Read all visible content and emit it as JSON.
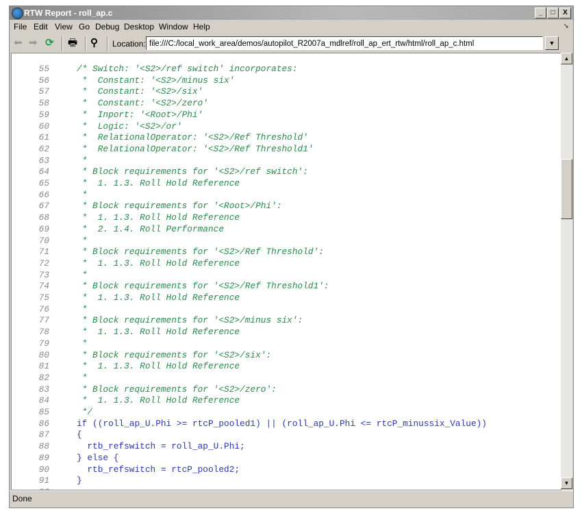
{
  "window": {
    "title": "RTW Report - roll_ap.c",
    "controls": [
      "_",
      "□",
      "X"
    ]
  },
  "menu": [
    "File",
    "Edit",
    "View",
    "Go",
    "Debug",
    "Desktop",
    "Window",
    "Help"
  ],
  "toolbar": {
    "location_label": "Location:",
    "location_value": "file:///C:/local_work_area/demos/autopilot_R2007a_mdlref/roll_ap_ert_rtw/html/roll_ap_c.html"
  },
  "code_lines": [
    {
      "n": "55",
      "text": "/* Switch: '<S2>/ref switch' incorporates:",
      "kind": "comment"
    },
    {
      "n": "56",
      "text": " *  Constant: '<S2>/minus six'",
      "kind": "comment"
    },
    {
      "n": "57",
      "text": " *  Constant: '<S2>/six'",
      "kind": "comment"
    },
    {
      "n": "58",
      "text": " *  Constant: '<S2>/zero'",
      "kind": "comment"
    },
    {
      "n": "59",
      "text": " *  Inport: '<Root>/Phi'",
      "kind": "comment"
    },
    {
      "n": "60",
      "text": " *  Logic: '<S2>/or'",
      "kind": "comment"
    },
    {
      "n": "61",
      "text": " *  RelationalOperator: '<S2>/Ref Threshold'",
      "kind": "comment"
    },
    {
      "n": "62",
      "text": " *  RelationalOperator: '<S2>/Ref Threshold1'",
      "kind": "comment"
    },
    {
      "n": "63",
      "text": " *",
      "kind": "comment"
    },
    {
      "n": "64",
      "text": " * Block requirements for '<S2>/ref switch':",
      "kind": "comment"
    },
    {
      "n": "65",
      "text": " *  1. 1.3. Roll Hold Reference",
      "kind": "comment"
    },
    {
      "n": "66",
      "text": " *",
      "kind": "comment"
    },
    {
      "n": "67",
      "text": " * Block requirements for '<Root>/Phi':",
      "kind": "comment"
    },
    {
      "n": "68",
      "text": " *  1. 1.3. Roll Hold Reference",
      "kind": "comment"
    },
    {
      "n": "69",
      "text": " *  2. 1.4. Roll Performance",
      "kind": "comment"
    },
    {
      "n": "70",
      "text": " *",
      "kind": "comment"
    },
    {
      "n": "71",
      "text": " * Block requirements for '<S2>/Ref Threshold':",
      "kind": "comment"
    },
    {
      "n": "72",
      "text": " *  1. 1.3. Roll Hold Reference",
      "kind": "comment"
    },
    {
      "n": "73",
      "text": " *",
      "kind": "comment"
    },
    {
      "n": "74",
      "text": " * Block requirements for '<S2>/Ref Threshold1':",
      "kind": "comment"
    },
    {
      "n": "75",
      "text": " *  1. 1.3. Roll Hold Reference",
      "kind": "comment"
    },
    {
      "n": "76",
      "text": " *",
      "kind": "comment"
    },
    {
      "n": "77",
      "text": " * Block requirements for '<S2>/minus six':",
      "kind": "comment"
    },
    {
      "n": "78",
      "text": " *  1. 1.3. Roll Hold Reference",
      "kind": "comment"
    },
    {
      "n": "79",
      "text": " *",
      "kind": "comment"
    },
    {
      "n": "80",
      "text": " * Block requirements for '<S2>/six':",
      "kind": "comment"
    },
    {
      "n": "81",
      "text": " *  1. 1.3. Roll Hold Reference",
      "kind": "comment"
    },
    {
      "n": "82",
      "text": " *",
      "kind": "comment"
    },
    {
      "n": "83",
      "text": " * Block requirements for '<S2>/zero':",
      "kind": "comment"
    },
    {
      "n": "84",
      "text": " *  1. 1.3. Roll Hold Reference",
      "kind": "comment"
    },
    {
      "n": "85",
      "text": " */",
      "kind": "comment"
    },
    {
      "n": "86",
      "text": "if ((roll_ap_U.Phi >= rtcP_pooled1) || (roll_ap_U.Phi <= rtcP_minussix_Value))",
      "kind": "code"
    },
    {
      "n": "87",
      "text": "{",
      "kind": "code"
    },
    {
      "n": "88",
      "text": "  rtb_refswitch = roll_ap_U.Phi;",
      "kind": "code"
    },
    {
      "n": "89",
      "text": "} else {",
      "kind": "code"
    },
    {
      "n": "90",
      "text": "  rtb_refswitch = rtcP_pooled2;",
      "kind": "code"
    },
    {
      "n": "91",
      "text": "}",
      "kind": "code"
    },
    {
      "n": "92",
      "text": "",
      "kind": "code"
    }
  ],
  "status": "Done",
  "colors": {
    "comment": "#2a8a4a",
    "code": "#2a3aa8",
    "line_number": "#888888"
  }
}
